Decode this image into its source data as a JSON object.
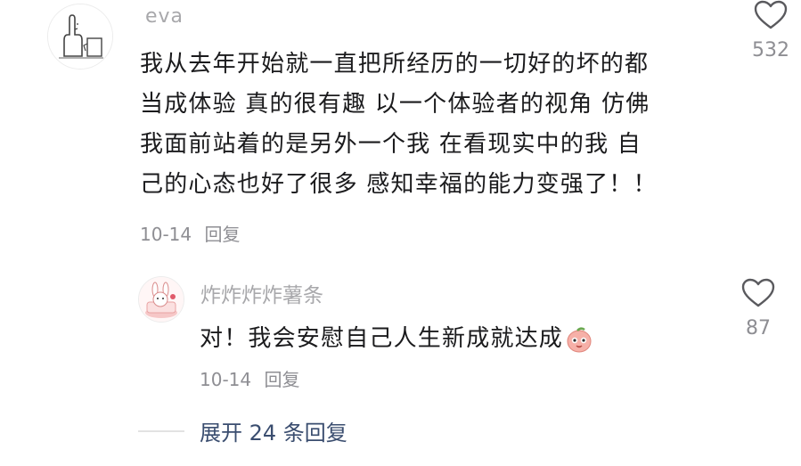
{
  "main_comment": {
    "username": "eva",
    "text_lines": [
      "我从去年开始就一直把所经历的一切好的坏的都",
      "当成体验 真的很有趣 以一个体验者的视角 仿佛",
      "我面前站着的是另外一个我 在看现实中的我 自",
      "己的心态也好了很多 感知幸福的能力变强了！！"
    ],
    "date": "10-14",
    "reply_label": "回复",
    "like_count": "532",
    "liked": false
  },
  "reply_comment": {
    "username": "炸炸炸炸薯条",
    "text": "对！我会安慰自己人生新成就达成",
    "emoji_icon": "peach-face-emoji",
    "date": "10-14",
    "reply_label": "回复",
    "like_count": "87",
    "liked": false
  },
  "expand_replies": "展开 24 条回复",
  "colors": {
    "text_primary": "#1b1b1d",
    "text_secondary": "#8e8e93",
    "username": "#a8a8ab",
    "expand_link": "#3a4d6f",
    "emoji_pink": "#f4a6a6"
  }
}
